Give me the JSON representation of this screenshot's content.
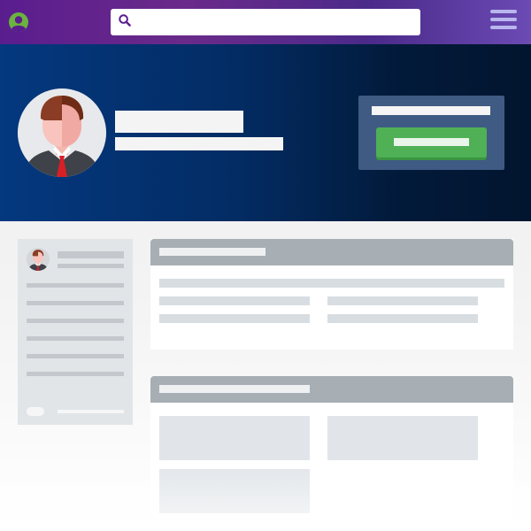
{
  "header": {
    "logo_icon": "user-circle-logo-icon",
    "search": {
      "icon": "search-icon",
      "value": "",
      "placeholder": ""
    },
    "menu_icon": "hamburger-menu-icon"
  },
  "profile": {
    "avatar_icon": "user-avatar-icon",
    "name": "",
    "subtitle": "",
    "action_label": "",
    "action_button_label": ""
  },
  "sidebar": {
    "avatar_icon": "user-avatar-icon",
    "name": "",
    "subtitle": ""
  },
  "sections": [
    {
      "title": ""
    },
    {
      "title": ""
    }
  ],
  "colors": {
    "top_bar": "#5a1d8e",
    "hero_start": "#04387f",
    "hero_end": "#02152f",
    "action_panel": "#3f5a83",
    "primary_button": "#4fb055",
    "card_header": "#a7aeb4",
    "placeholder": "#d8dde1"
  }
}
